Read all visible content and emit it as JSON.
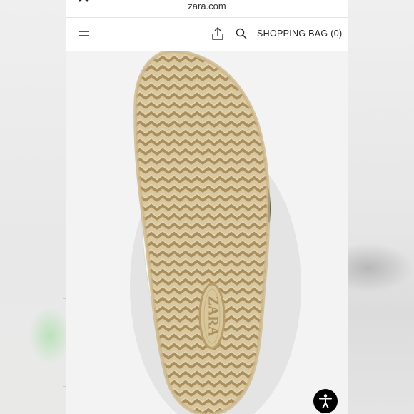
{
  "browser": {
    "url": "zara.com"
  },
  "header": {
    "shopping_bag_label": "SHOPPING BAG (0)"
  },
  "product": {
    "brand_mark": "ZARA",
    "sole_color": "#c2a978",
    "upper_color": "#f4f2ec"
  },
  "colors": {
    "accessibility_bg": "#000000",
    "header_bg": "#ffffff"
  },
  "icons": [
    "close-icon",
    "tabs-icon",
    "share-network-icon",
    "bookmark-icon",
    "more-icon",
    "hamburger-menu-icon",
    "share-icon",
    "search-icon",
    "accessibility-icon"
  ]
}
